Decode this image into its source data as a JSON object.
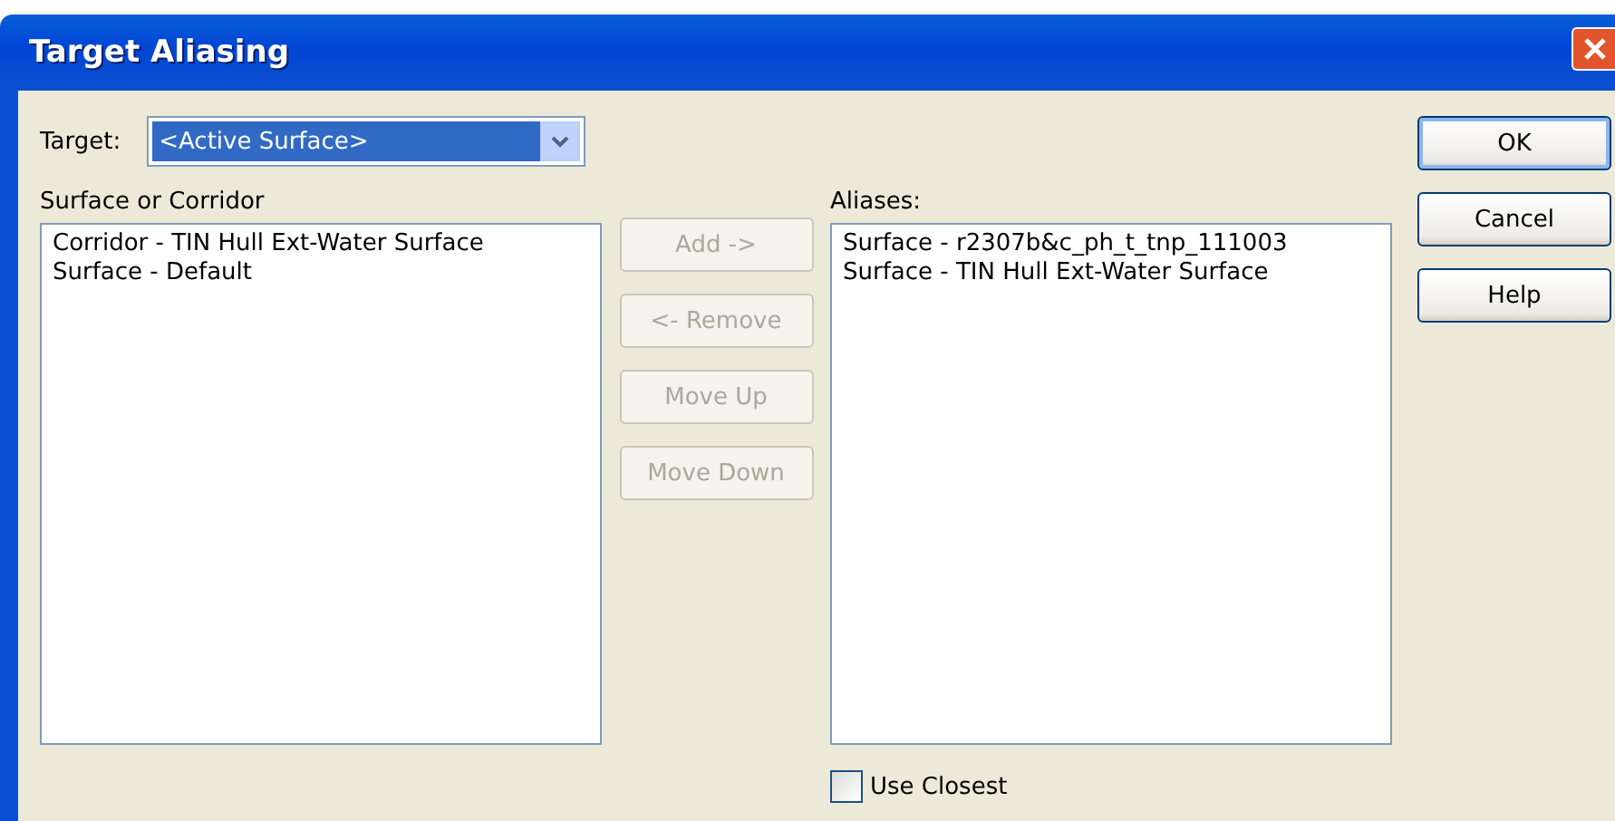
{
  "window": {
    "title": "Target Aliasing"
  },
  "target": {
    "label": "Target:",
    "value": "<Active Surface>",
    "focused": true
  },
  "source": {
    "label": "Surface or Corridor",
    "items": [
      "Corridor - TIN Hull Ext-Water Surface",
      "Surface - Default"
    ]
  },
  "middle_buttons": [
    {
      "label": "Add ->",
      "disabled": true
    },
    {
      "label": "<- Remove",
      "disabled": true
    },
    {
      "label": "Move Up",
      "disabled": true
    },
    {
      "label": "Move Down",
      "disabled": true
    }
  ],
  "aliases": {
    "label": "Aliases:",
    "items": [
      "Surface - r2307b&c_ph_t_tnp_111003",
      "Surface - TIN Hull Ext-Water Surface"
    ]
  },
  "use_closest": {
    "label": "Use Closest",
    "checked": false
  },
  "buttons": [
    {
      "label": "OK",
      "default": true
    },
    {
      "label": "Cancel",
      "default": false
    },
    {
      "label": "Help",
      "default": false
    }
  ]
}
